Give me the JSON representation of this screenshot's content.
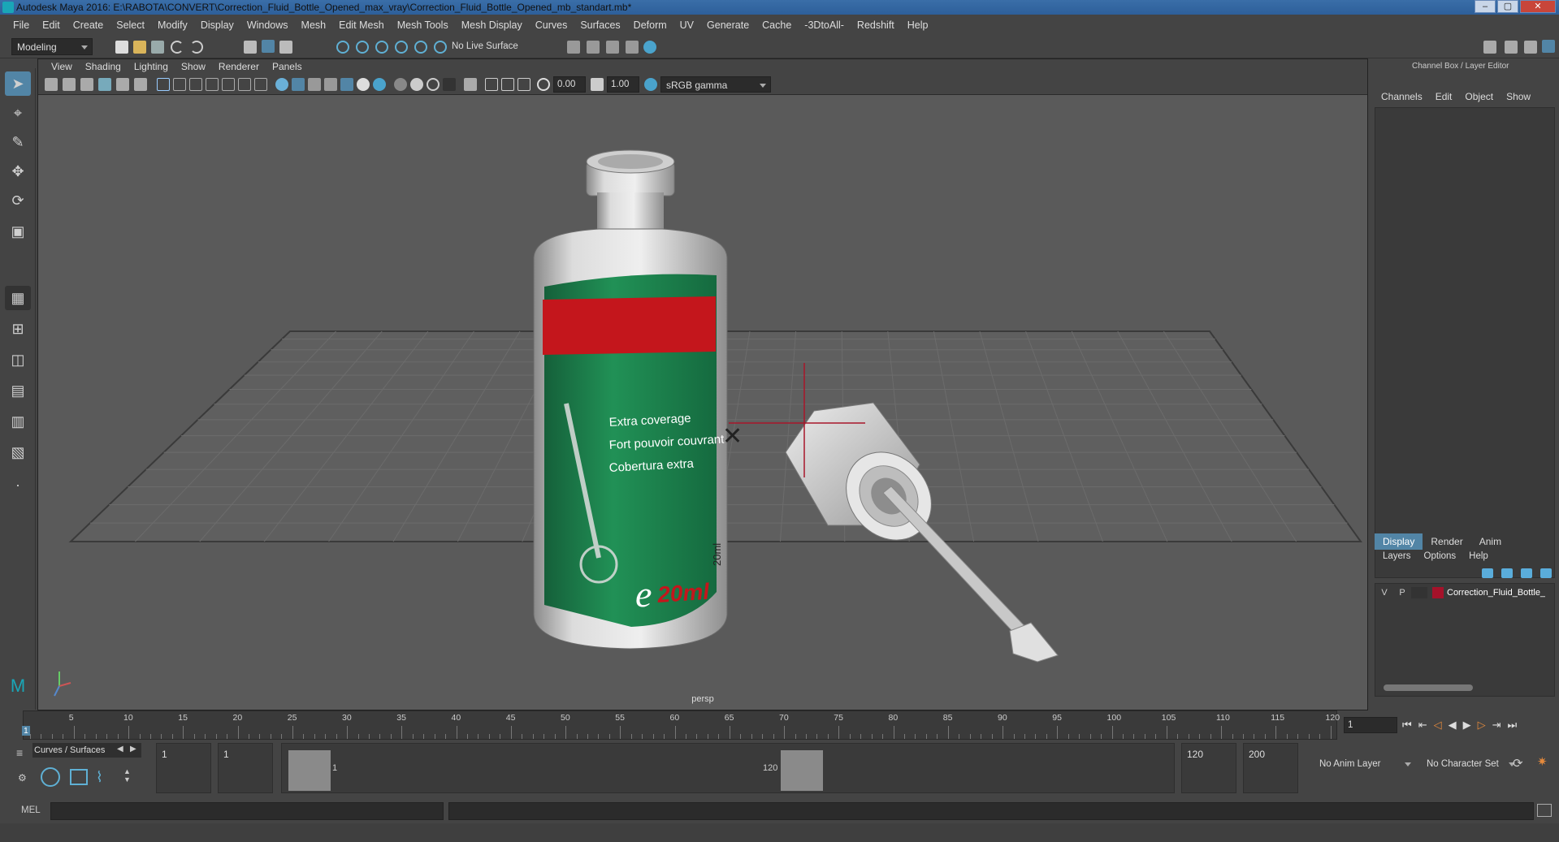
{
  "window": {
    "title": "Autodesk Maya 2016: E:\\RABOTA\\CONVERT\\Correction_Fluid_Bottle_Opened_max_vray\\Correction_Fluid_Bottle_Opened_mb_standart.mb*"
  },
  "menu": [
    "File",
    "Edit",
    "Create",
    "Select",
    "Modify",
    "Display",
    "Windows",
    "Mesh",
    "Edit Mesh",
    "Mesh Tools",
    "Mesh Display",
    "Curves",
    "Surfaces",
    "Deform",
    "UV",
    "Generate",
    "Cache",
    "-3DtoAll-",
    "Redshift",
    "Help"
  ],
  "shelf": {
    "mode": "Modeling",
    "live_surface": "No Live Surface"
  },
  "viewport": {
    "menu": [
      "View",
      "Shading",
      "Lighting",
      "Show",
      "Renderer",
      "Panels"
    ],
    "exposure": "0.00",
    "gamma": "1.00",
    "color_space": "sRGB gamma",
    "camera_label": "persp",
    "label_lines": [
      "Extra coverage",
      "Fort pouvoir couvrant",
      "Cobertura extra"
    ],
    "volume_label": "20ml",
    "brand_letter": "e",
    "side_label": "20ml"
  },
  "right_panel": {
    "title": "Channel Box / Layer Editor",
    "channel_tabs": [
      "Channels",
      "Edit",
      "Object",
      "Show"
    ],
    "layer_tabs": [
      "Display",
      "Render",
      "Anim"
    ],
    "layer_menu": [
      "Layers",
      "Options",
      "Help"
    ],
    "layer": {
      "v": "V",
      "p": "P",
      "name": "Correction_Fluid_Bottle_",
      "color": "#a5122a"
    }
  },
  "timeline": {
    "ticks": [
      "5",
      "10",
      "15",
      "20",
      "25",
      "30",
      "35",
      "40",
      "45",
      "50",
      "55",
      "60",
      "65",
      "70",
      "75",
      "80",
      "85",
      "90",
      "95",
      "100",
      "105",
      "110",
      "115",
      "120"
    ],
    "start_marker": "1",
    "current_frame": "1"
  },
  "range": {
    "shelf_tab": "Curves / Surfaces",
    "start": "1",
    "inner_start": "1",
    "slider_start": "1",
    "slider_end": "120",
    "end": "120",
    "total_end": "200",
    "anim_layer": "No Anim Layer",
    "char_set": "No Character Set"
  },
  "command": {
    "lang": "MEL"
  },
  "colors": {
    "accent": "#5285a6",
    "bottle_green": "#1f8a55",
    "bottle_red": "#c4161c",
    "grid": "#6a6a6a"
  }
}
